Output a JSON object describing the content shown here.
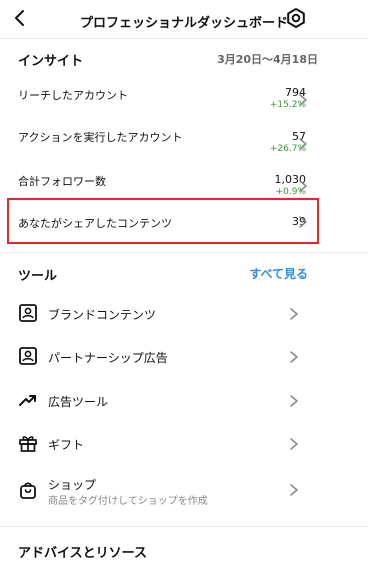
{
  "header": {
    "title": "プロフェッショナルダッシュボード"
  },
  "insights": {
    "title": "インサイト",
    "date_range": "3月20日〜4月18日",
    "rows": [
      {
        "label": "リーチしたアカウント",
        "value": "794",
        "change": "+15.2%"
      },
      {
        "label": "アクションを実行したアカウント",
        "value": "57",
        "change": "+26.7%"
      },
      {
        "label": "合計フォロワー数",
        "value": "1,030",
        "change": "+0.9%"
      },
      {
        "label": "あなたがシェアしたコンテンツ",
        "value": "39",
        "change": ""
      }
    ]
  },
  "tools": {
    "title": "ツール",
    "see_all": "すべて見る",
    "items": [
      {
        "label": "ブランドコンテンツ",
        "icon": "brand-content-icon",
        "sub": ""
      },
      {
        "label": "パートナーシップ広告",
        "icon": "partnership-ads-icon",
        "sub": ""
      },
      {
        "label": "広告ツール",
        "icon": "trending-up-icon",
        "sub": ""
      },
      {
        "label": "ギフト",
        "icon": "gift-icon",
        "sub": ""
      },
      {
        "label": "ショップ",
        "icon": "shopping-bag-icon",
        "sub": "商品をタグ付けしてショップを作成"
      }
    ]
  },
  "advice": {
    "title": "アドバイスとリソース"
  },
  "colors": {
    "accent_link": "#2f8ee0",
    "positive_change": "#3a9b3a",
    "highlight_border": "#e02a2a"
  }
}
